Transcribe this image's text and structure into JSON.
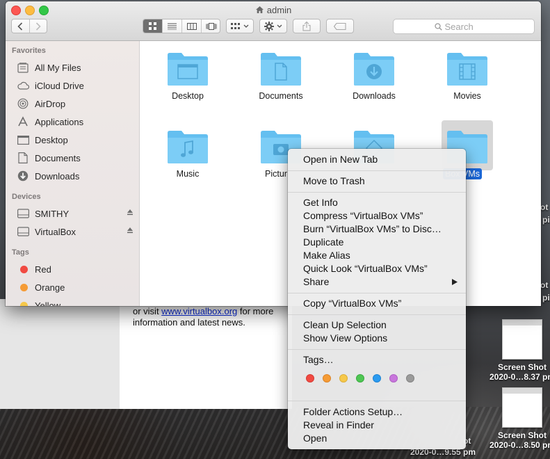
{
  "window": {
    "title": "admin"
  },
  "toolbar": {
    "search_placeholder": "Search"
  },
  "sidebar": {
    "favorites_header": "Favorites",
    "favorites": [
      {
        "label": "All My Files",
        "icon": "all-files-icon"
      },
      {
        "label": "iCloud Drive",
        "icon": "cloud-icon"
      },
      {
        "label": "AirDrop",
        "icon": "airdrop-icon"
      },
      {
        "label": "Applications",
        "icon": "applications-icon"
      },
      {
        "label": "Desktop",
        "icon": "desktop-icon"
      },
      {
        "label": "Documents",
        "icon": "documents-icon"
      },
      {
        "label": "Downloads",
        "icon": "downloads-icon"
      }
    ],
    "devices_header": "Devices",
    "devices": [
      {
        "label": "SMITHY",
        "icon": "drive-icon"
      },
      {
        "label": "VirtualBox",
        "icon": "drive-icon"
      }
    ],
    "tags_header": "Tags",
    "tags": [
      {
        "label": "Red",
        "color": "#f14a42"
      },
      {
        "label": "Orange",
        "color": "#f59b35"
      },
      {
        "label": "Yellow",
        "color": "#f6c84a"
      }
    ]
  },
  "folders": [
    {
      "label": "Desktop",
      "icon": "desktop-folder-icon"
    },
    {
      "label": "Documents",
      "icon": "documents-folder-icon"
    },
    {
      "label": "Downloads",
      "icon": "downloads-folder-icon"
    },
    {
      "label": "Movies",
      "icon": "movies-folder-icon"
    },
    {
      "label": "Music",
      "icon": "music-folder-icon"
    },
    {
      "label": "Pictur",
      "icon": "pictures-folder-icon"
    },
    {
      "label": "",
      "icon": "public-folder-icon"
    },
    {
      "label": "Box VMs",
      "icon": "folder-icon",
      "selected": true
    }
  ],
  "context_menu": {
    "items": [
      "Open in New Tab",
      "Move to Trash",
      "Get Info",
      "Compress “VirtualBox VMs”",
      "Burn “VirtualBox VMs” to Disc…",
      "Duplicate",
      "Make Alias",
      "Quick Look “VirtualBox VMs”",
      "Share",
      "Copy “VirtualBox VMs”",
      "Clean Up Selection",
      "Show View Options",
      "Tags…",
      "Folder Actions Setup…",
      "Reveal in Finder",
      "Open"
    ],
    "tag_colors": [
      "#f14a42",
      "#f59b35",
      "#f6c84a",
      "#4ec653",
      "#2b9bf0",
      "#c876dc",
      "#9a9a9a"
    ]
  },
  "background_window": {
    "line1_prefix": "or visit ",
    "link": "www.virtualbox.org",
    "line1_suffix": " for more",
    "line2": "information and latest news."
  },
  "desktop": {
    "files": [
      {
        "name": "Screen Shot",
        "date": "2020-0…8.37 pm"
      },
      {
        "name": "Screen Shot",
        "date": "2020-0…8.50 pm"
      }
    ],
    "partial_date": "2020-0…9.55 pm",
    "partial_shot": "ot",
    "edge_labels": [
      "ot",
      "pi",
      "ot",
      "pi"
    ]
  }
}
